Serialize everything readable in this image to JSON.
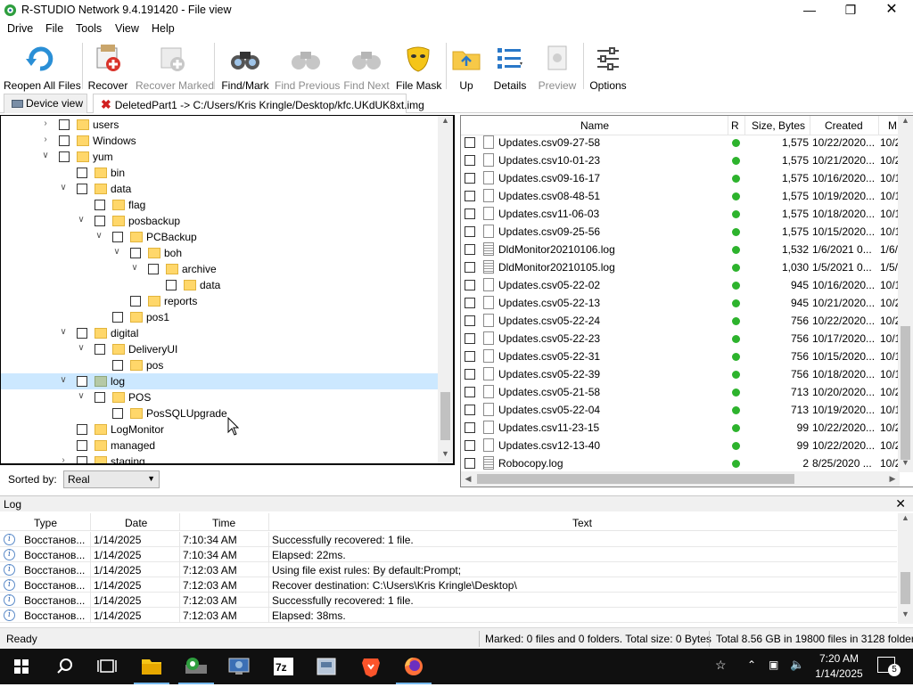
{
  "window": {
    "title": "R-STUDIO Network 9.4.191420 - File view"
  },
  "menu": [
    "Drive",
    "File",
    "Tools",
    "View",
    "Help"
  ],
  "toolbar": {
    "reopen": "Reopen All Files",
    "recover": "Recover",
    "recover_marked": "Recover Marked",
    "find_mark": "Find/Mark",
    "find_previous": "Find Previous",
    "find_next": "Find Next",
    "file_mask": "File Mask",
    "up": "Up",
    "details": "Details",
    "preview": "Preview",
    "options": "Options"
  },
  "tabs": {
    "device_view": "Device view",
    "active": "DeletedPart1 -> C:/Users/Kris Kringle/Desktop/kfc.UKdUK8xt.img"
  },
  "tree": [
    {
      "label": "users",
      "depth": 0,
      "arrow": "collapsed"
    },
    {
      "label": "Windows",
      "depth": 0,
      "arrow": "collapsed"
    },
    {
      "label": "yum",
      "depth": 0,
      "arrow": "expanded"
    },
    {
      "label": "bin",
      "depth": 1,
      "arrow": "none"
    },
    {
      "label": "data",
      "depth": 1,
      "arrow": "expanded"
    },
    {
      "label": "flag",
      "depth": 2,
      "arrow": "none"
    },
    {
      "label": "posbackup",
      "depth": 2,
      "arrow": "expanded"
    },
    {
      "label": "PCBackup",
      "depth": 3,
      "arrow": "expanded"
    },
    {
      "label": "boh",
      "depth": 4,
      "arrow": "expanded"
    },
    {
      "label": "archive",
      "depth": 5,
      "arrow": "expanded"
    },
    {
      "label": "data",
      "depth": 6,
      "arrow": "none"
    },
    {
      "label": "reports",
      "depth": 4,
      "arrow": "none"
    },
    {
      "label": "pos1",
      "depth": 3,
      "arrow": "none"
    },
    {
      "label": "digital",
      "depth": 1,
      "arrow": "expanded"
    },
    {
      "label": "DeliveryUI",
      "depth": 2,
      "arrow": "expanded"
    },
    {
      "label": "pos",
      "depth": 3,
      "arrow": "none"
    },
    {
      "label": "log",
      "depth": 1,
      "arrow": "expanded",
      "selected": true
    },
    {
      "label": "POS",
      "depth": 2,
      "arrow": "expanded"
    },
    {
      "label": "PosSQLUpgrade",
      "depth": 3,
      "arrow": "none",
      "hover": true
    },
    {
      "label": "LogMonitor",
      "depth": 1,
      "arrow": "none"
    },
    {
      "label": "managed",
      "depth": 1,
      "arrow": "none"
    },
    {
      "label": "staging",
      "depth": 1,
      "arrow": "collapsed"
    }
  ],
  "sort": {
    "label": "Sorted by:",
    "value": "Real"
  },
  "list": {
    "columns": {
      "name": "Name",
      "r": "R",
      "size": "Size, Bytes",
      "created": "Created",
      "modified": "M"
    },
    "rows": [
      {
        "name": "Updates.csv09-27-58",
        "size": "1,575",
        "created": "10/22/2020...",
        "modified": "10/2",
        "type": "file"
      },
      {
        "name": "Updates.csv10-01-23",
        "size": "1,575",
        "created": "10/21/2020...",
        "modified": "10/2",
        "type": "file"
      },
      {
        "name": "Updates.csv09-16-17",
        "size": "1,575",
        "created": "10/16/2020...",
        "modified": "10/1",
        "type": "file"
      },
      {
        "name": "Updates.csv08-48-51",
        "size": "1,575",
        "created": "10/19/2020...",
        "modified": "10/1",
        "type": "file"
      },
      {
        "name": "Updates.csv11-06-03",
        "size": "1,575",
        "created": "10/18/2020...",
        "modified": "10/1",
        "type": "file"
      },
      {
        "name": "Updates.csv09-25-56",
        "size": "1,575",
        "created": "10/15/2020...",
        "modified": "10/1",
        "type": "file"
      },
      {
        "name": "DldMonitor20210106.log",
        "size": "1,532",
        "created": "1/6/2021 0...",
        "modified": "1/6/",
        "type": "log"
      },
      {
        "name": "DldMonitor20210105.log",
        "size": "1,030",
        "created": "1/5/2021 0...",
        "modified": "1/5/",
        "type": "log"
      },
      {
        "name": "Updates.csv05-22-02",
        "size": "945",
        "created": "10/16/2020...",
        "modified": "10/1",
        "type": "file"
      },
      {
        "name": "Updates.csv05-22-13",
        "size": "945",
        "created": "10/21/2020...",
        "modified": "10/2",
        "type": "file"
      },
      {
        "name": "Updates.csv05-22-24",
        "size": "756",
        "created": "10/22/2020...",
        "modified": "10/2",
        "type": "file"
      },
      {
        "name": "Updates.csv05-22-23",
        "size": "756",
        "created": "10/17/2020...",
        "modified": "10/1",
        "type": "file"
      },
      {
        "name": "Updates.csv05-22-31",
        "size": "756",
        "created": "10/15/2020...",
        "modified": "10/1",
        "type": "file"
      },
      {
        "name": "Updates.csv05-22-39",
        "size": "756",
        "created": "10/18/2020...",
        "modified": "10/1",
        "type": "file"
      },
      {
        "name": "Updates.csv05-21-58",
        "size": "713",
        "created": "10/20/2020...",
        "modified": "10/2",
        "type": "file"
      },
      {
        "name": "Updates.csv05-22-04",
        "size": "713",
        "created": "10/19/2020...",
        "modified": "10/1",
        "type": "file"
      },
      {
        "name": "Updates.csv11-23-15",
        "size": "99",
        "created": "10/22/2020...",
        "modified": "10/2",
        "type": "file"
      },
      {
        "name": "Updates.csv12-13-40",
        "size": "99",
        "created": "10/22/2020...",
        "modified": "10/2",
        "type": "file"
      },
      {
        "name": "Robocopy.log",
        "size": "2",
        "created": "8/25/2020 ...",
        "modified": "10/2",
        "type": "log"
      }
    ]
  },
  "log": {
    "title": "Log",
    "columns": {
      "type": "Type",
      "date": "Date",
      "time": "Time",
      "text": "Text"
    },
    "rows": [
      {
        "type": "Восстанов...",
        "date": "1/14/2025",
        "time": "7:10:34 AM",
        "text": "Successfully recovered: 1 file."
      },
      {
        "type": "Восстанов...",
        "date": "1/14/2025",
        "time": "7:10:34 AM",
        "text": "Elapsed: 22ms."
      },
      {
        "type": "Восстанов...",
        "date": "1/14/2025",
        "time": "7:12:03 AM",
        "text": "Using file exist rules: By default:Prompt;"
      },
      {
        "type": "Восстанов...",
        "date": "1/14/2025",
        "time": "7:12:03 AM",
        "text": "Recover destination: C:\\Users\\Kris Kringle\\Desktop\\"
      },
      {
        "type": "Восстанов...",
        "date": "1/14/2025",
        "time": "7:12:03 AM",
        "text": "Successfully recovered: 1 file."
      },
      {
        "type": "Восстанов...",
        "date": "1/14/2025",
        "time": "7:12:03 AM",
        "text": "Elapsed: 38ms."
      }
    ]
  },
  "status": {
    "ready": "Ready",
    "marked": "Marked: 0 files and 0 folders. Total size: 0 Bytes",
    "total": "Total 8.56 GB in 19800 files in 3128 folders"
  },
  "taskbar": {
    "time": "7:20 AM",
    "date": "1/14/2025",
    "notifications": "5",
    "icons": [
      "windows-start-icon",
      "search-icon",
      "task-view-icon",
      "file-explorer-icon",
      "rstudio-icon",
      "network-tool-icon",
      "7zip-icon",
      "disk-tool-icon",
      "brave-icon",
      "firefox-icon"
    ]
  },
  "colors": {
    "selected_row": "#cce8ff",
    "recovered_dot": "#2db32d",
    "folder": "#ffd76a",
    "taskbar": "#101010"
  }
}
